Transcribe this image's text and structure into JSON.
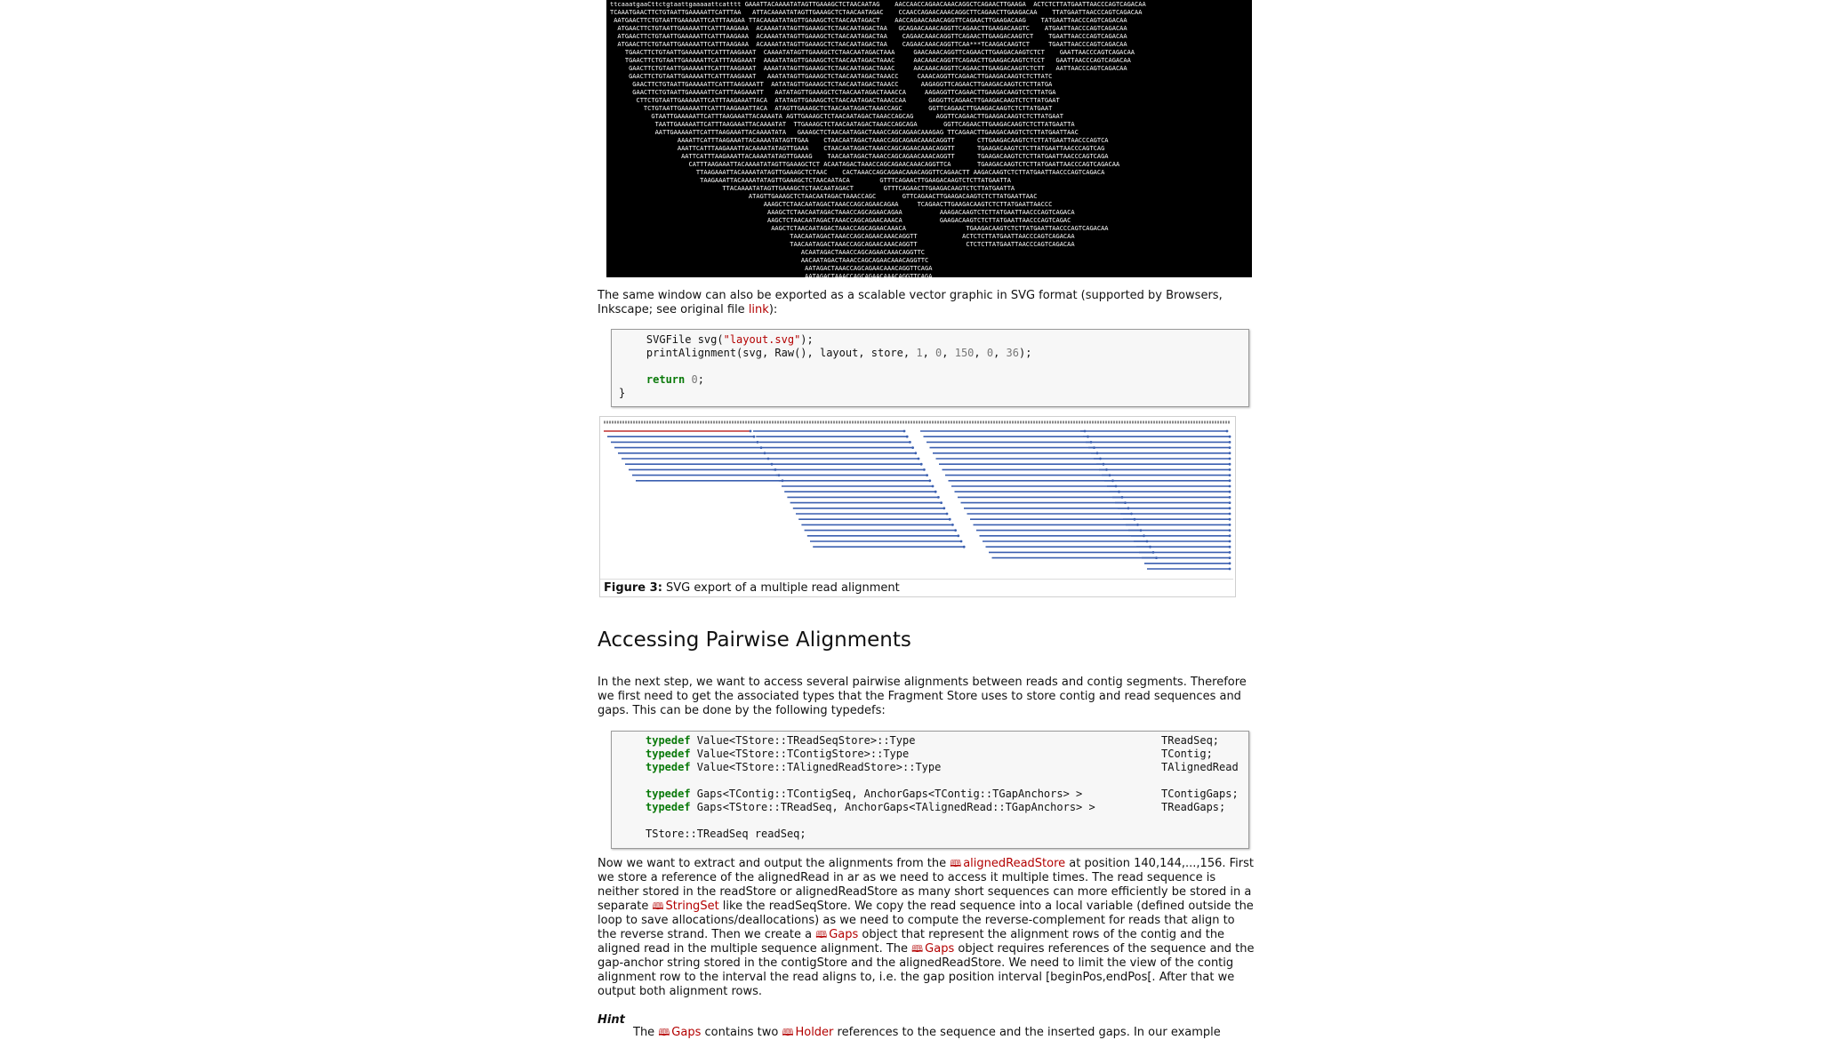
{
  "ascii_alignment": {
    "lines": [
      "ttcaaatgaaCttctgtaattgaaaaattcatttt GAAATTACAAAATATAGTTGAAAGCTCTAACAATAG    AACCAACCAGAACAAACAGGCTCAGAACTTGAAGA  ACTCTCTTATGAATTAACCCAGTCAGACAA",
      "TCAAATGAACTTCTGTAATTGAAAAATTCATTTAA   ATTACAAAATATAGTTGAAAGCTCTAACAATAGAC    CCAACCAGAACAAACAGGCTTCAGAACTTGAAGACAA    TTATGAATTAACCCAGTCAGACAA",
      " AATGAACTTCTGTAATTGAAAAATTCATTTAAGAA TTACAAAATATAGTTGAAAGCTCTAACAATAGACT    AACCAGAACAAACAGGTTCAGAACTTGAAGACAAG    TATGAATTAACCCAGTCAGACAA",
      "  ATGAACTTCTGTAATTGAAAAATTCATTTAAGAAA  ACAAAATATAGTTGAAAGCTCTAACAATAGACTAA   GCAGAACAAACAGGTTCAGAACTTGAAGACAAGTC    ATGAATTAACCCAGTCAGACAA",
      "  ATGAACTTCTGTAATTGAAAAATTCATTTAAGAAA  ACAAAATATAGTTGAAAGCTCTAACAATAGACTAA    CAGAACAAACAGGTTCAGAACTTGAAGACAAGTCT    TGAATTAACCCAGTCAGACAA",
      "  ATGAACTTCTGTAATTGAAAAATTCATTTAAGAAA  ACAAAATATAGTTGAAAGCTCTAACAATAGACTAA    CAGAACAAACAGGTTCAA***TCAAGACAAGTCT     TGAATTAACCCAGTCAGACAA",
      "    TGAACTTCTGTAATTGAAAAATTCATTTAAGAAAT  CAAAATATAGTTGAAAGCTCTAACAATAGACTAAA     GAACAAACAGGTTCAGAACTTGAAGACAAGTCTCT    GAATTAACCCAGTCAGACAA",
      "    TGAACTTCTGTAATTGAAAAATTCATTTAAGAAAT  AAAATATAGTTGAAAGCTCTAACAATAGACTAAAC     AACAAACAGGTTCAGAACTTGAAGACAAGTCTCCT   GAATTAACCCAGTCAGACAA",
      "     GAACTTCTGTAATTGAAAAATTCATTTAAGAAAT  AAAATATAGTTGAAAGCTCTAACAATAGACTAAAC     AACAAACAGGTTCAGAACTTGAAGACAAGTCTCTT   AATTAACCCAGTCAGACAA",
      "     GAACTTCTGTAATTGAAAAATTCATTTAAGAAAT   AAATATAGTTGAAAGCTCTAACAATAGACTAAACC     CAAACAGGTTCAGAACTTGAAGACAAGTCTCTTATC",
      "      GAACTTCTGTAATTGAAAAATTCATTTAAGAAATT  AATATAGTTGAAAGCTCTAACAATAGACTAAACC      AAGAGGTTCAGAACTTGAAGACAAGTCTCTTATGA",
      "      GAACTTCTGTAATTGAAAAATTCATTTAAGAAATT   AATATAGTTGAAAGCTCTAACAATAGACTAAACCA     AAGAGGTTCAGAACTTGAAGACAAGTCTCTTATGA",
      "       CTTCTGTAATTGAAAAATTCATTTAAGAAATTACA  ATATAGTTGAAAGCTCTAACAATAGACTAAACCAA      GAGGTTCAGAACTTGAAGACAAGTCTCTTATGAAT",
      "         TCTGTAATTGAAAAATTCATTTAAGAAATTACA  ATAGTTGAAAGCTCTAACAATAGACTAAACCAGC       GGTTCAGAACTTGAAGACAAGTCTCTTATGAAT",
      "           GTAATTGAAAAATTCATTTAAGAAATTACAAAATA AGTTGAAAGCTCTAACAATAGACTAAACCAGCAG      AGGTTCAGAACTTGAAGACAAGTCTCTTATGAAT",
      "            TAATTGAAAAATTCATTTAAGAAATTACAAAATAT  TTGAAAGCTCTAACAATAGACTAAACCAGCAGA       GGTTCAGAACTTGAAGACAAGTCTCTTATGAATTA",
      "            AATTGAAAAATTCATTTAAGAAATTACAAAATATA   GAAAGCTCTAACAATAGACTAAACCAGCAGAACAAAGAG TTCAGAACTTGAAGACAAGTCTCTTATGAATTAAC",
      "                  AAAATTCATTTAAGAAATTACAAAATATAGTTGAA    CTAACAATAGACTAAACCAGCAGAACAAACAGGTT      CTTGAAGACAAGTCTCTTATGAATTAACCCAGTCA",
      "                  AAATTCATTTAAGAAATTACAAAATATAGTTGAAA    CTAACAATAGACTAAACCAGCAGAACAAACAGGTT      TGAAGACAAGTCTCTTATGAATTAACCCAGTCAG",
      "                   AATTCATTTAAGAAATTACAAAATATAGTTGAAAG    TAACAATAGACTAAACCAGCAGAACAAACAGGTT      TGAAGACAAGTCTCTTATGAATTAACCCAGTCAGA",
      "                     CATTTAAGAAATTACAAAATATAGTTGAAAGCTCT ACAATAGACTAAACCAGCAGAACAAACAGGTTCA       TGAAGACAAGTCTCTTATGAATTAACCCAGTCAGACAA",
      "                       TTAAGAAATTACAAAATATAGTTGAAAGCTCTAAC    CACTAAACCAGCAGAACAAACAGGTTCAGAACTT AAGACAAGTCTCTTATGAATTAACCCAGTCAGACA",
      "                        TAAGAAATTACAAAATATAGTTGAAAGCTCTAACAATACA        GTTTCAGAACTTGAAGACAAGTCTCTTATGAATTA",
      "                              TTACAAAATATAGTTGAAAGCTCTAACAATAGACT        GTTTCAGAACTTGAAGACAAGTCTCTTATGAATTA",
      "                                     ATAGTTGAAAGCTCTAACAATAGACTAAACCAGC       GTTCAGAACTTGAAGACAAGTCTCTTATGAATTAAC",
      "                                         AAAGCTCTAACAATAGACTAAACCAGCAGAACAGAA     TCAGAACTTGAAGACAAGTCTCTTATGAATTAACCC",
      "                                          AAAGCTCTAACAATAGACTAAACCAGCAGAACAGAA          AAAGACAAGTCTCTTATGAATTAACCCAGTCAGACA",
      "                                          AAGCTCTAACAATAGACTAAACCAGCAGAACAAACA          GAAGACAAGTCTCTTATGAATTAACCCAGTCAGAC",
      "                                           AAGCTCTAACAATAGACTAAACCAGCAGAACAAACA                TGAAGACAAGTCTCTTATGAATTAACCCAGTCAGACAA",
      "                                                TAACAATAGACTAAACCAGCAGAACAAACAGGTT            ACTCTCTTATGAATTAACCCAGTCAGACAA",
      "                                                TAACAATAGACTAAACCAGCAGAACAAACAGGTT             CTCTCTTATGAATTAACCCAGTCAGACAA",
      "                                                   ACAATAGACTAAACCAGCAGAACAAACAGGTTC",
      "                                                   AACAATAGACTAAACCAGCAGAACAAACAGGTTC",
      "                                                    AATAGACTAAACCAGCAGAACAAACAGGTTCAGA",
      "                                                    AATAGACTAAACCAGCAGAACAAACAGGTTCAGA"
    ]
  },
  "intro_paragraph": {
    "text": "The same window can also be exported as a scalable vector graphic in SVG format (supported by Browsers, Inkscape; see original file ",
    "link": "link",
    "after": "):"
  },
  "code1": {
    "l1_a": "    SVGFile svg(",
    "l1_str": "\"layout.svg\"",
    "l1_b": ");",
    "l2_a": "    printAlignment(svg, Raw(), layout, store, ",
    "l2_n1": "1",
    "l2_sep1": ", ",
    "l2_n2": "0",
    "l2_sep2": ", ",
    "l2_n3": "150",
    "l2_sep3": ", ",
    "l2_n4": "0",
    "l2_sep4": ", ",
    "l2_n5": "36",
    "l2_b": ");",
    "l4_indent": "    ",
    "l4_kw": "return",
    "l4_sp": " ",
    "l4_n": "0",
    "l4_b": ";",
    "l5": "}"
  },
  "figure3": {
    "label": "Figure 3:",
    "caption": " SVG export of a multiple read alignment",
    "ref_colors": {
      "read": "#3a5fb0",
      "reverse": "#c03030",
      "header": "#888888"
    }
  },
  "section": {
    "title": "Accessing Pairwise Alignments"
  },
  "para2": {
    "text": "In the next step, we want to access several pairwise alignments between reads and contig segments. Therefore we first need to get the associated types that the Fragment Store uses to store contig and read sequences and gaps. This can be done by the following typedefs:"
  },
  "code2": {
    "kw": "typedef",
    "r1": " Value<TStore::TReadSeqStore>::Type",
    "r1t": "TReadSeq;",
    "r2": " Value<TStore::TContigStore>::Type",
    "r2t": "TContig;",
    "r3": " Value<TStore::TAlignedReadStore>::Type",
    "r3t": "TAlignedRead",
    "r4": " Gaps<TContig::TContigSeq, AnchorGaps<TContig::TGapAnchors> >",
    "r4t": "TContigGaps;",
    "r5": " Gaps<TStore::TReadSeq, AnchorGaps<TAlignedRead::TGapAnchors> >",
    "r5t": "TReadGaps;",
    "r6": "TStore::TReadSeq readSeq;"
  },
  "para3": {
    "s1": "Now we want to extract and output the alignments from the ",
    "link1": "alignedReadStore",
    "s2": " at position 140,144,...,156. First we store a reference of the alignedRead in ar as we need to access it multiple times. The read sequence is neither stored in the readStore or alignedReadStore as many short sequences can more efficiently be stored in a separate ",
    "link2": "StringSet",
    "s3": " like the readSeqStore. We copy the read sequence into a local variable (defined outside the loop to save allocations/deallocations) as we need to compute the reverse-complement for reads that align to the reverse strand. Then we create a ",
    "link3": "Gaps",
    "s4": " object that represent the alignment rows of the contig and the aligned read in the multiple sequence alignment. The ",
    "link4": "Gaps",
    "s5": " object requires references of the sequence and the gap-anchor string stored in the contigStore and the alignedReadStore. We need to limit the view of the contig alignment row to the interval the read aligns to, i.e. the gap position interval [beginPos,endPos[. After that we output both alignment rows."
  },
  "hint": {
    "title": "Hint",
    "s1": "The ",
    "link1": "Gaps",
    "s2": " contains two ",
    "link2": "Holder",
    "s3": " references to the sequence and the inserted gaps. In our example"
  },
  "icons": {
    "doc_link": "book-icon"
  }
}
